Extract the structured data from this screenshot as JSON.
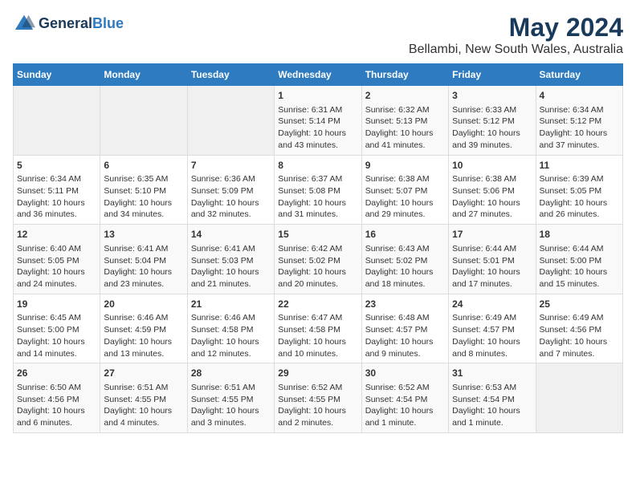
{
  "header": {
    "title": "May 2024",
    "subtitle": "Bellambi, New South Wales, Australia",
    "logo_line1": "General",
    "logo_line2": "Blue"
  },
  "days_of_week": [
    "Sunday",
    "Monday",
    "Tuesday",
    "Wednesday",
    "Thursday",
    "Friday",
    "Saturday"
  ],
  "weeks": [
    [
      {
        "day": "",
        "info": ""
      },
      {
        "day": "",
        "info": ""
      },
      {
        "day": "",
        "info": ""
      },
      {
        "day": "1",
        "info": "Sunrise: 6:31 AM\nSunset: 5:14 PM\nDaylight: 10 hours and 43 minutes."
      },
      {
        "day": "2",
        "info": "Sunrise: 6:32 AM\nSunset: 5:13 PM\nDaylight: 10 hours and 41 minutes."
      },
      {
        "day": "3",
        "info": "Sunrise: 6:33 AM\nSunset: 5:12 PM\nDaylight: 10 hours and 39 minutes."
      },
      {
        "day": "4",
        "info": "Sunrise: 6:34 AM\nSunset: 5:12 PM\nDaylight: 10 hours and 37 minutes."
      }
    ],
    [
      {
        "day": "5",
        "info": "Sunrise: 6:34 AM\nSunset: 5:11 PM\nDaylight: 10 hours and 36 minutes."
      },
      {
        "day": "6",
        "info": "Sunrise: 6:35 AM\nSunset: 5:10 PM\nDaylight: 10 hours and 34 minutes."
      },
      {
        "day": "7",
        "info": "Sunrise: 6:36 AM\nSunset: 5:09 PM\nDaylight: 10 hours and 32 minutes."
      },
      {
        "day": "8",
        "info": "Sunrise: 6:37 AM\nSunset: 5:08 PM\nDaylight: 10 hours and 31 minutes."
      },
      {
        "day": "9",
        "info": "Sunrise: 6:38 AM\nSunset: 5:07 PM\nDaylight: 10 hours and 29 minutes."
      },
      {
        "day": "10",
        "info": "Sunrise: 6:38 AM\nSunset: 5:06 PM\nDaylight: 10 hours and 27 minutes."
      },
      {
        "day": "11",
        "info": "Sunrise: 6:39 AM\nSunset: 5:05 PM\nDaylight: 10 hours and 26 minutes."
      }
    ],
    [
      {
        "day": "12",
        "info": "Sunrise: 6:40 AM\nSunset: 5:05 PM\nDaylight: 10 hours and 24 minutes."
      },
      {
        "day": "13",
        "info": "Sunrise: 6:41 AM\nSunset: 5:04 PM\nDaylight: 10 hours and 23 minutes."
      },
      {
        "day": "14",
        "info": "Sunrise: 6:41 AM\nSunset: 5:03 PM\nDaylight: 10 hours and 21 minutes."
      },
      {
        "day": "15",
        "info": "Sunrise: 6:42 AM\nSunset: 5:02 PM\nDaylight: 10 hours and 20 minutes."
      },
      {
        "day": "16",
        "info": "Sunrise: 6:43 AM\nSunset: 5:02 PM\nDaylight: 10 hours and 18 minutes."
      },
      {
        "day": "17",
        "info": "Sunrise: 6:44 AM\nSunset: 5:01 PM\nDaylight: 10 hours and 17 minutes."
      },
      {
        "day": "18",
        "info": "Sunrise: 6:44 AM\nSunset: 5:00 PM\nDaylight: 10 hours and 15 minutes."
      }
    ],
    [
      {
        "day": "19",
        "info": "Sunrise: 6:45 AM\nSunset: 5:00 PM\nDaylight: 10 hours and 14 minutes."
      },
      {
        "day": "20",
        "info": "Sunrise: 6:46 AM\nSunset: 4:59 PM\nDaylight: 10 hours and 13 minutes."
      },
      {
        "day": "21",
        "info": "Sunrise: 6:46 AM\nSunset: 4:58 PM\nDaylight: 10 hours and 12 minutes."
      },
      {
        "day": "22",
        "info": "Sunrise: 6:47 AM\nSunset: 4:58 PM\nDaylight: 10 hours and 10 minutes."
      },
      {
        "day": "23",
        "info": "Sunrise: 6:48 AM\nSunset: 4:57 PM\nDaylight: 10 hours and 9 minutes."
      },
      {
        "day": "24",
        "info": "Sunrise: 6:49 AM\nSunset: 4:57 PM\nDaylight: 10 hours and 8 minutes."
      },
      {
        "day": "25",
        "info": "Sunrise: 6:49 AM\nSunset: 4:56 PM\nDaylight: 10 hours and 7 minutes."
      }
    ],
    [
      {
        "day": "26",
        "info": "Sunrise: 6:50 AM\nSunset: 4:56 PM\nDaylight: 10 hours and 6 minutes."
      },
      {
        "day": "27",
        "info": "Sunrise: 6:51 AM\nSunset: 4:55 PM\nDaylight: 10 hours and 4 minutes."
      },
      {
        "day": "28",
        "info": "Sunrise: 6:51 AM\nSunset: 4:55 PM\nDaylight: 10 hours and 3 minutes."
      },
      {
        "day": "29",
        "info": "Sunrise: 6:52 AM\nSunset: 4:55 PM\nDaylight: 10 hours and 2 minutes."
      },
      {
        "day": "30",
        "info": "Sunrise: 6:52 AM\nSunset: 4:54 PM\nDaylight: 10 hours and 1 minute."
      },
      {
        "day": "31",
        "info": "Sunrise: 6:53 AM\nSunset: 4:54 PM\nDaylight: 10 hours and 1 minute."
      },
      {
        "day": "",
        "info": ""
      }
    ]
  ]
}
